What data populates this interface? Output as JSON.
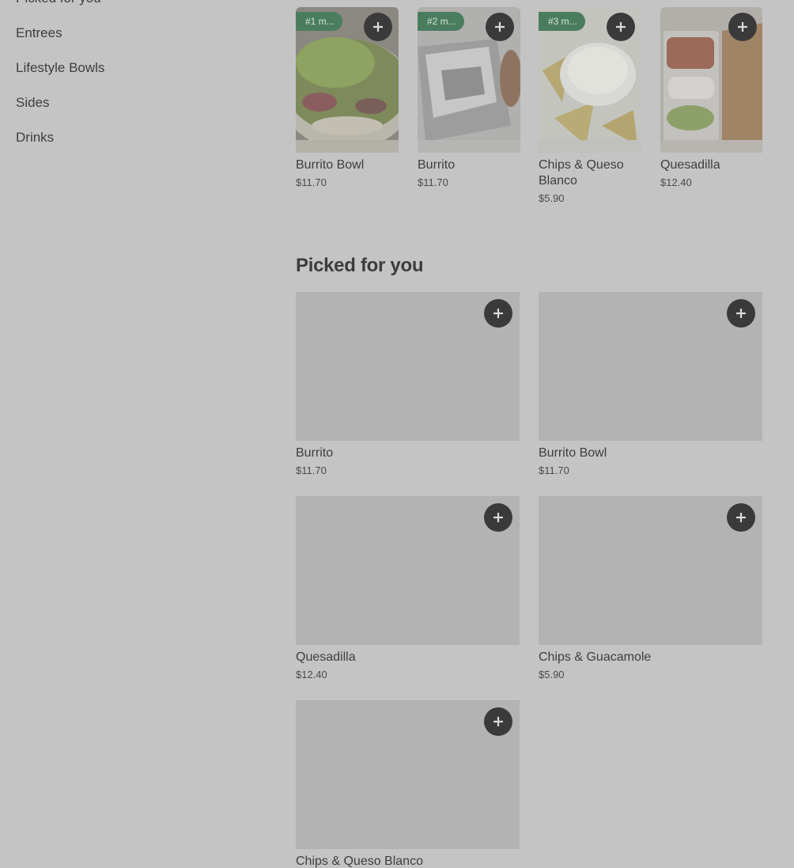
{
  "sidebar": {
    "items": [
      {
        "label": "Picked for you"
      },
      {
        "label": "Entrees"
      },
      {
        "label": "Lifestyle Bowls"
      },
      {
        "label": "Sides"
      },
      {
        "label": "Drinks"
      }
    ]
  },
  "popular": {
    "items": [
      {
        "badge": "#1 m...",
        "name": "Burrito Bowl",
        "price": "$11.70"
      },
      {
        "badge": "#2 m...",
        "name": "Burrito",
        "price": "$11.70"
      },
      {
        "badge": "#3 m...",
        "name": "Chips & Queso Blanco",
        "price": "$5.90"
      },
      {
        "badge": "",
        "name": "Quesadilla",
        "price": "$12.40"
      }
    ]
  },
  "picked": {
    "title": "Picked for you",
    "items": [
      {
        "name": "Burrito",
        "price": "$11.70"
      },
      {
        "name": "Burrito Bowl",
        "price": "$11.70"
      },
      {
        "name": "Quesadilla",
        "price": "$12.40"
      },
      {
        "name": "Chips & Guacamole",
        "price": "$5.90"
      },
      {
        "name": "Chips & Queso Blanco",
        "price": ""
      }
    ]
  },
  "icons": {
    "add": "plus-icon"
  },
  "colors": {
    "overlay_bg": "#c4c4c4",
    "badge": "#4a7d5e",
    "add_button": "#3a3a3a"
  }
}
